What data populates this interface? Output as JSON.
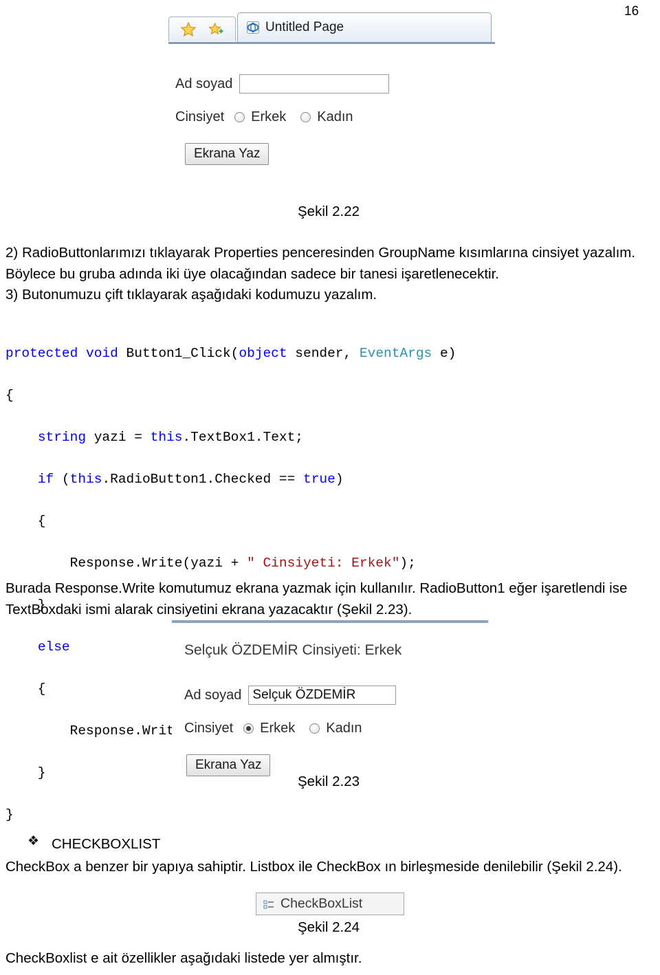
{
  "page": {
    "number": "16"
  },
  "figure1": {
    "browser": {
      "tab_title": "Untitled Page",
      "favorites_icon": "star-icon",
      "add-favorites_icon": "star-plus-icon",
      "page_icon": "ie-page-icon"
    },
    "form": {
      "name_label": "Ad soyad",
      "name_value": "",
      "name_placeholder": "",
      "gender_label": "Cinsiyet",
      "radio_male": "Erkek",
      "radio_female": "Kadın",
      "male_checked": false,
      "female_checked": false,
      "button_label": "Ekrana Yaz"
    },
    "caption": "Şekil 2.22"
  },
  "steps": [
    {
      "num": "2)",
      "text": "RadioButtonlarımızı tıklayarak Properties penceresinden GroupName kısımlarına cinsiyet yazalım. Böylece bu gruba adında iki üye olacağından sadece bir tanesi işaretlenecektir."
    },
    {
      "num": "3)",
      "text": "Butonumuzu çift tıklayarak aşağıdaki kodumuzu yazalım."
    }
  ],
  "code": {
    "lines": [
      "protected void Button1_Click(object sender, EventArgs e)",
      "{",
      "    string yazi = this.TextBox1.Text;",
      "    if (this.RadioButton1.Checked == true)",
      "    {",
      "        Response.Write(yazi + \" Cinsiyeti: Erkek\");",
      "    }",
      "    else",
      "    {",
      "        Response.Write(yazi + \" Cinsiyeti: Kadın\");",
      "    }",
      "}"
    ]
  },
  "paragraph1": "Burada Response.Write komutumuz ekrana yazmak için kullanılır. RadioButton1 eğer işaretlendi ise TextBoxdaki ismi alarak cinsiyetini ekrana yazacaktır (Şekil 2.23).",
  "figure2": {
    "output_text": "Selçuk ÖZDEMİR Cinsiyeti: Erkek",
    "form": {
      "name_label": "Ad soyad",
      "name_value": "Selçuk ÖZDEMİR",
      "gender_label": "Cinsiyet",
      "radio_male": "Erkek",
      "radio_female": "Kadın",
      "male_checked": true,
      "female_checked": false,
      "button_label": "Ekrana Yaz"
    },
    "caption": "Şekil 2.23"
  },
  "section": {
    "bullet": "❖",
    "title": "CHECKBOXLIST",
    "text": "CheckBox a benzer bir yapıya sahiptir. Listbox ile CheckBox ın birleşmeside denilebilir (Şekil 2.24)."
  },
  "figure3": {
    "control_label": "CheckBoxList",
    "control_icon": "checkboxlist-icon",
    "caption": "Şekil 2.24"
  },
  "paragraph2": "CheckBoxlist e ait özellikler aşağıdaki listede yer almıştır."
}
